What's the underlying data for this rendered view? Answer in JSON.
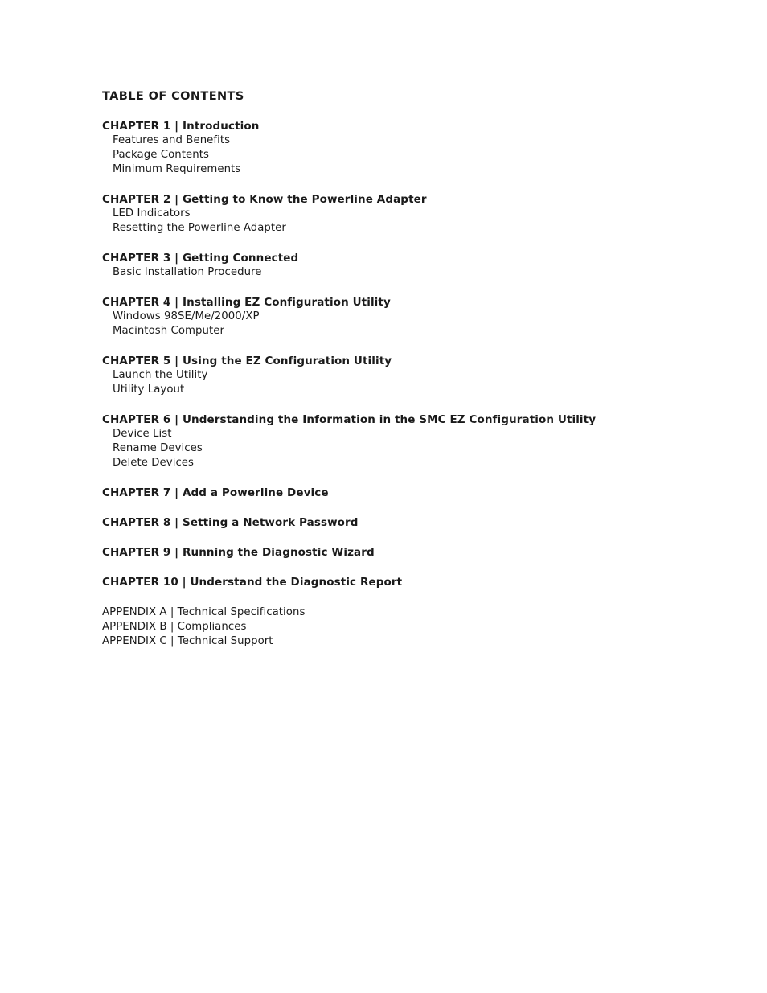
{
  "document": {
    "title": "TABLE OF CONTENTS",
    "text_color": "#1a1a1a",
    "background_color": "#ffffff"
  },
  "chapters": [
    {
      "heading": "CHAPTER 1 | Introduction",
      "items": [
        "Features and Benefits",
        "Package Contents",
        "Minimum Requirements"
      ]
    },
    {
      "heading": "CHAPTER 2 | Getting to Know the Powerline Adapter",
      "items": [
        "LED Indicators",
        "Resetting the Powerline Adapter"
      ]
    },
    {
      "heading": "CHAPTER 3 | Getting Connected",
      "items": [
        "Basic Installation Procedure"
      ]
    },
    {
      "heading": "CHAPTER 4 | Installing EZ Configuration Utility",
      "items": [
        "Windows 98SE/Me/2000/XP",
        "Macintosh Computer"
      ]
    },
    {
      "heading": "CHAPTER 5 | Using the EZ Configuration Utility",
      "items": [
        "Launch the Utility",
        "Utility Layout"
      ]
    },
    {
      "heading": "CHAPTER 6 | Understanding the Information in the SMC EZ Configuration Utility",
      "items": [
        "Device List",
        "Rename Devices",
        "Delete Devices"
      ]
    },
    {
      "heading": "CHAPTER 7 | Add a Powerline Device",
      "items": []
    },
    {
      "heading": "CHAPTER 8 | Setting a Network Password",
      "items": []
    },
    {
      "heading": "CHAPTER 9 | Running the Diagnostic Wizard",
      "items": []
    },
    {
      "heading": "CHAPTER 10 | Understand the Diagnostic Report",
      "items": []
    }
  ],
  "appendices": [
    "APPENDIX A | Technical Specifications",
    "APPENDIX B | Compliances",
    "APPENDIX C | Technical Support"
  ]
}
